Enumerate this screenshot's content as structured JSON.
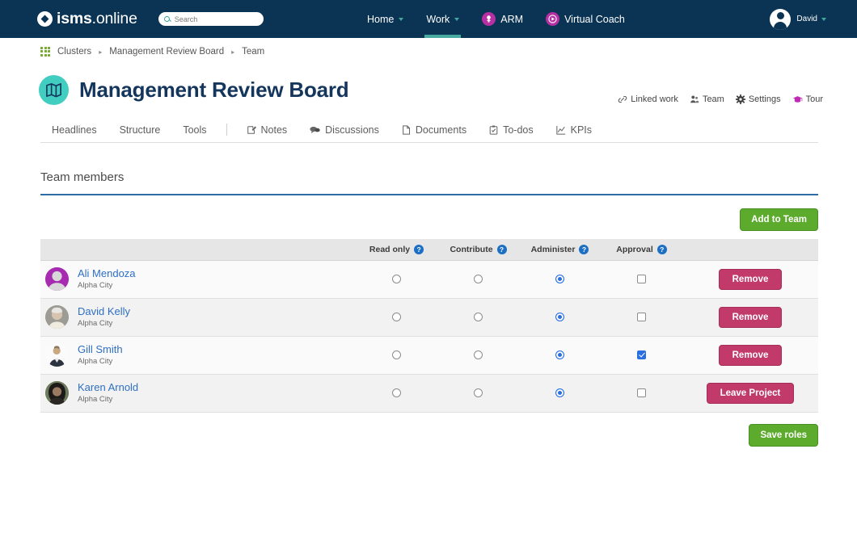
{
  "nav": {
    "logo": {
      "bold": "isms",
      "rest": ".online",
      "icon": "isms-logo-icon"
    },
    "search": {
      "placeholder": "Search",
      "value": "",
      "icon": "search-icon"
    },
    "items": [
      {
        "label": "Home",
        "caret": true,
        "active": false,
        "icon": null
      },
      {
        "label": "Work",
        "caret": true,
        "active": true,
        "icon": null
      },
      {
        "label": "ARM",
        "caret": false,
        "active": false,
        "icon": "arm-badge-icon"
      },
      {
        "label": "Virtual Coach",
        "caret": false,
        "active": false,
        "icon": "play-badge-icon"
      }
    ],
    "user": {
      "name": "David",
      "avatar": "user-avatar-icon",
      "caret": true
    },
    "colors": {
      "bar": "#0a3354",
      "accent": "#47aba0",
      "badge": "#b62fa3"
    }
  },
  "breadcrumb": {
    "icon": "clusters-grid-icon",
    "separator": "▸",
    "items": [
      "Clusters",
      "Management Review Board",
      "Team"
    ]
  },
  "header": {
    "icon": "map-book-icon",
    "icon_bg": "#41cdbf",
    "title": "Management Review Board",
    "actions": [
      {
        "label": "Linked work",
        "icon": "link-icon"
      },
      {
        "label": "Team",
        "icon": "team-icon"
      },
      {
        "label": "Settings",
        "icon": "gear-icon"
      },
      {
        "label": "Tour",
        "icon": "graduation-cap-icon"
      }
    ]
  },
  "tabs": [
    {
      "label": "Headlines",
      "icon": null
    },
    {
      "label": "Structure",
      "icon": null
    },
    {
      "label": "Tools",
      "icon": null
    },
    {
      "label": "Notes",
      "icon": "note-edit-icon"
    },
    {
      "label": "Discussions",
      "icon": "discussions-icon"
    },
    {
      "label": "Documents",
      "icon": "document-icon"
    },
    {
      "label": "To-dos",
      "icon": "checklist-icon"
    },
    {
      "label": "KPIs",
      "icon": "chart-line-icon"
    }
  ],
  "section": {
    "title": "Team members",
    "underline_color": "#2e6da4",
    "add_button": "Add to Team",
    "save_button": "Save roles"
  },
  "table": {
    "columns": [
      {
        "label": "Read only",
        "help": "?"
      },
      {
        "label": "Contribute",
        "help": "?"
      },
      {
        "label": "Administer",
        "help": "?"
      },
      {
        "label": "Approval",
        "help": "?"
      }
    ],
    "rows": [
      {
        "name": "Ali Mendoza",
        "location": "Alpha City",
        "avatar_bg": "#a62bb0",
        "avatar_kind": "silhouette",
        "read_only": false,
        "contribute": false,
        "administer": true,
        "approval": false,
        "action": "Remove"
      },
      {
        "name": "David Kelly",
        "location": "Alpha City",
        "avatar_bg": "#9b9b96",
        "avatar_kind": "photo-light",
        "read_only": false,
        "contribute": false,
        "administer": true,
        "approval": false,
        "action": "Remove"
      },
      {
        "name": "Gill Smith",
        "location": "Alpha City",
        "avatar_bg": "#ffffff",
        "avatar_kind": "photo-suit",
        "read_only": false,
        "contribute": false,
        "administer": true,
        "approval": true,
        "action": "Remove"
      },
      {
        "name": "Karen Arnold",
        "location": "Alpha City",
        "avatar_bg": "#5d6b52",
        "avatar_kind": "photo-dark",
        "read_only": false,
        "contribute": false,
        "administer": true,
        "approval": false,
        "action": "Leave Project"
      }
    ]
  }
}
